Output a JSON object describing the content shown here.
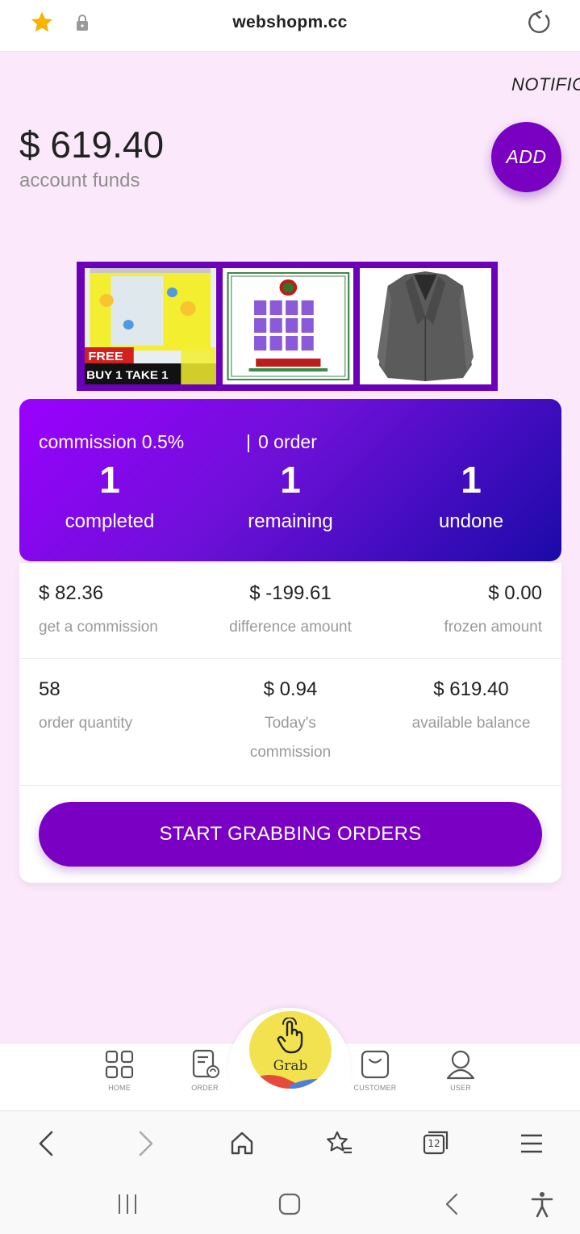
{
  "browser": {
    "url": "webshopm.cc"
  },
  "header": {
    "notification": "NOTIFIC",
    "funds_amount": "$ 619.40",
    "funds_label": "account funds",
    "add_label": "ADD"
  },
  "banner": {
    "tile1_badge": "FREE",
    "tile1_caption": "BUY 1 TAKE 1"
  },
  "stats": {
    "commission": "commission 0.5%",
    "separator": "|",
    "orders": "0 order",
    "completed_value": "1",
    "completed_label": "completed",
    "remaining_value": "1",
    "remaining_label": "remaining",
    "undone_value": "1",
    "undone_label": "undone"
  },
  "details": {
    "get_commission_value": "$ 82.36",
    "get_commission_label": "get a commission",
    "difference_value": "$ -199.61",
    "difference_label": "difference amount",
    "frozen_value": "$ 0.00",
    "frozen_label": "frozen amount",
    "order_quantity_value": "58",
    "order_quantity_label": "order quantity",
    "today_value": "$ 0.94",
    "today_label": "Today's commission",
    "available_value": "$ 619.40",
    "available_label": "available balance",
    "start_button": "START GRABBING ORDERS"
  },
  "tabs": {
    "home": "HOME",
    "order": "ORDER",
    "grab": "Grab",
    "customer": "CUSTOMER",
    "user": "USER"
  },
  "browser_nav": {
    "tab_count": "12"
  },
  "colors": {
    "accent": "#7a00c4",
    "background": "#fbe9fb",
    "star": "#f5b400",
    "grab_yellow": "#f2e250"
  }
}
